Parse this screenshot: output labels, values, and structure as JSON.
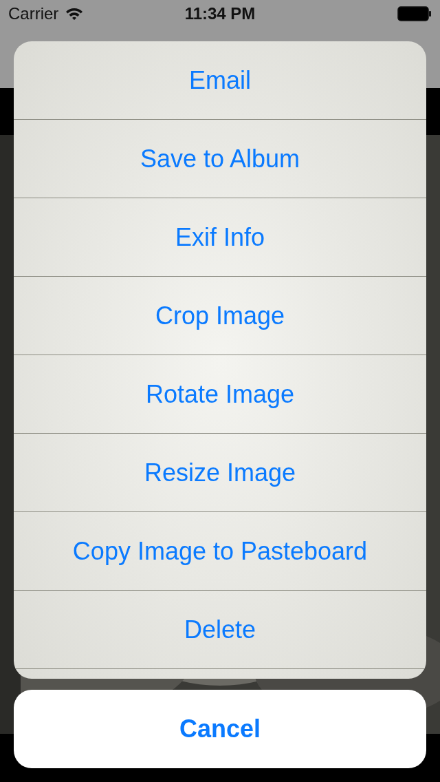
{
  "status_bar": {
    "carrier": "Carrier",
    "time": "11:34 PM"
  },
  "action_sheet": {
    "actions": [
      {
        "label": "Email"
      },
      {
        "label": "Save to Album"
      },
      {
        "label": "Exif Info"
      },
      {
        "label": "Crop Image"
      },
      {
        "label": "Rotate Image"
      },
      {
        "label": "Resize Image"
      },
      {
        "label": "Copy Image to Pasteboard"
      },
      {
        "label": "Delete"
      }
    ],
    "cancel": "Cancel"
  }
}
